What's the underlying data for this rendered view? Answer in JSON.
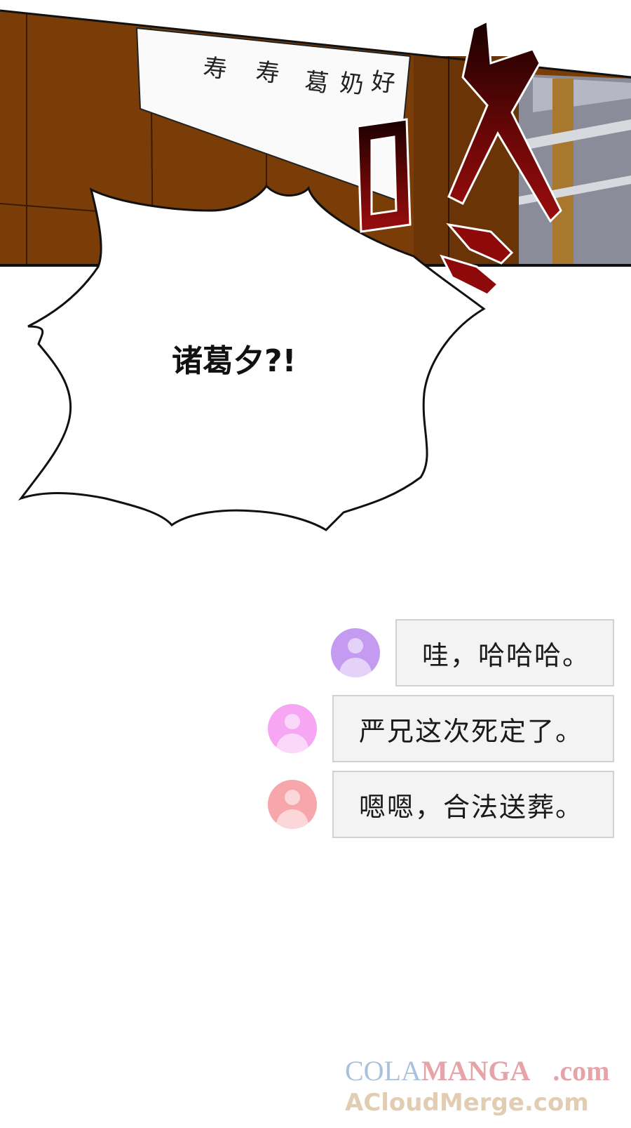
{
  "panel": {
    "sound_effect": "咚",
    "scroll_marks": [
      "寿",
      "寿",
      "葛",
      "奶",
      "好"
    ]
  },
  "bubble": {
    "text": "诸葛夕?!"
  },
  "chat": {
    "messages": [
      {
        "text": "哇，哈哈哈。",
        "avatar_color": "#c49bf0"
      },
      {
        "text": "严兄这次死定了。",
        "avatar_color": "#f6a6f2"
      },
      {
        "text": "嗯嗯，合法送葬。",
        "avatar_color": "#f7a6ac"
      }
    ]
  },
  "watermark": {
    "line1_a": "COLA",
    "line1_b": "MANGA",
    "line1_c": ".com",
    "line2": "ACloudMerge.com"
  },
  "colors": {
    "wood": "#7a3d08",
    "sfx_red": "#8e0a0a",
    "chat_bg": "#f3f3f3"
  }
}
